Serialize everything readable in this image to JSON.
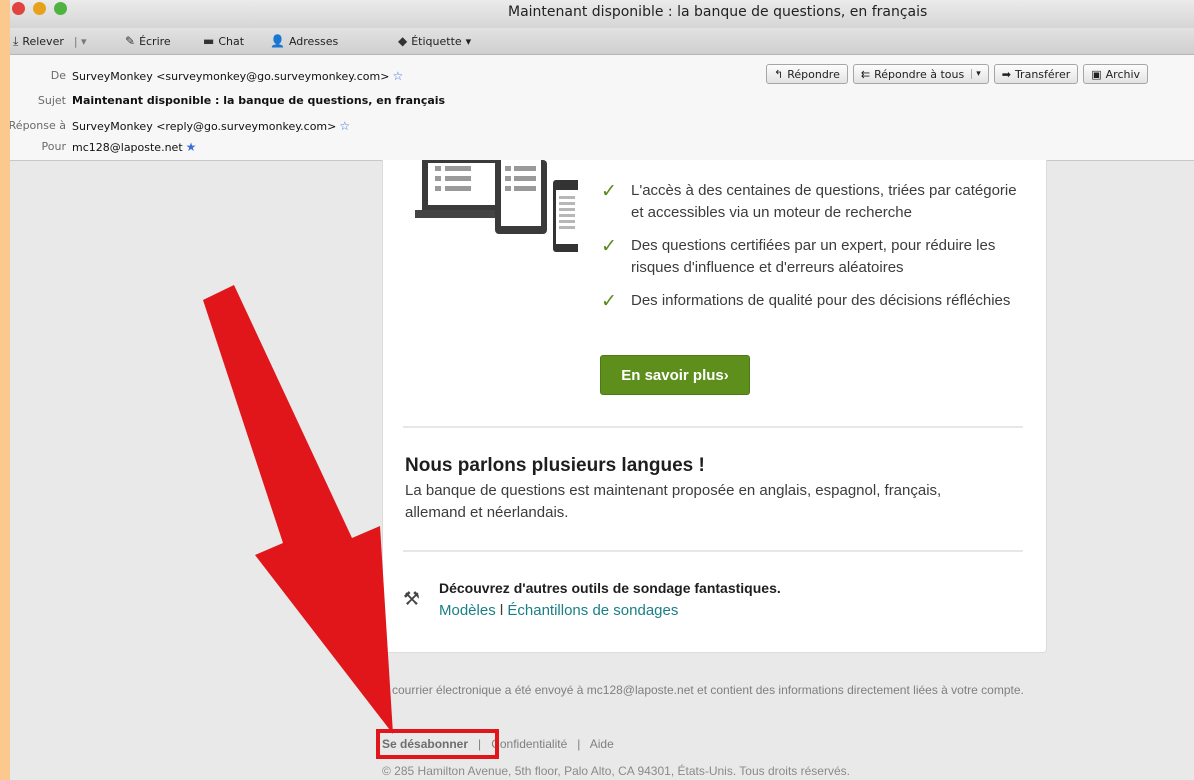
{
  "window": {
    "title": "Maintenant disponible : la banque de questions, en français"
  },
  "toolbar": {
    "get": "Relever",
    "write": "Écrire",
    "chat": "Chat",
    "addresses": "Adresses",
    "tag": "Étiquette"
  },
  "header": {
    "from_label": "De",
    "from_value": "SurveyMonkey <surveymonkey@go.surveymonkey.com>",
    "subject_label": "Sujet",
    "subject_value": "Maintenant disponible : la banque de questions, en français",
    "replyto_label": "Réponse à",
    "replyto_value": "SurveyMonkey <reply@go.surveymonkey.com>",
    "to_label": "Pour",
    "to_value": "mc128@laposte.net",
    "buttons": {
      "reply": "Répondre",
      "reply_all": "Répondre à tous",
      "forward": "Transférer",
      "archive": "Archiv"
    }
  },
  "email": {
    "benefits": [
      "L'accès à des centaines de questions, triées par catégorie et accessibles via un moteur de recherche",
      "Des questions certifiées par un expert, pour réduire les risques d'influence et d'erreurs aléatoires",
      "Des informations de qualité pour des décisions réfléchies"
    ],
    "cta_label": "En savoir plus›",
    "lang_title": "Nous parlons plusieurs langues !",
    "lang_text": "La banque de questions est maintenant proposée en anglais, espagnol, français, allemand et néerlandais.",
    "tools_title": "Découvrez d'autres outils de sondage fantastiques.",
    "tools_link_templates": "Modèles",
    "tools_link_sep": "l",
    "tools_link_samples": "Échantillons de sondages"
  },
  "footer": {
    "notice": "e courrier électronique a été envoyé à mc128@laposte.net et contient des informations directement liées à votre compte.",
    "unsubscribe": "Se désabonner",
    "sep": "|",
    "privacy": "Confidentialité",
    "help": "Aide",
    "address": "© 285 Hamilton Avenue, 5th floor, Palo Alto, CA 94301, États-Unis. Tous droits réservés."
  },
  "colors": {
    "accent_green": "#5e8f1d",
    "annotation_red": "#e0161b",
    "link_teal": "#1a7f86"
  }
}
